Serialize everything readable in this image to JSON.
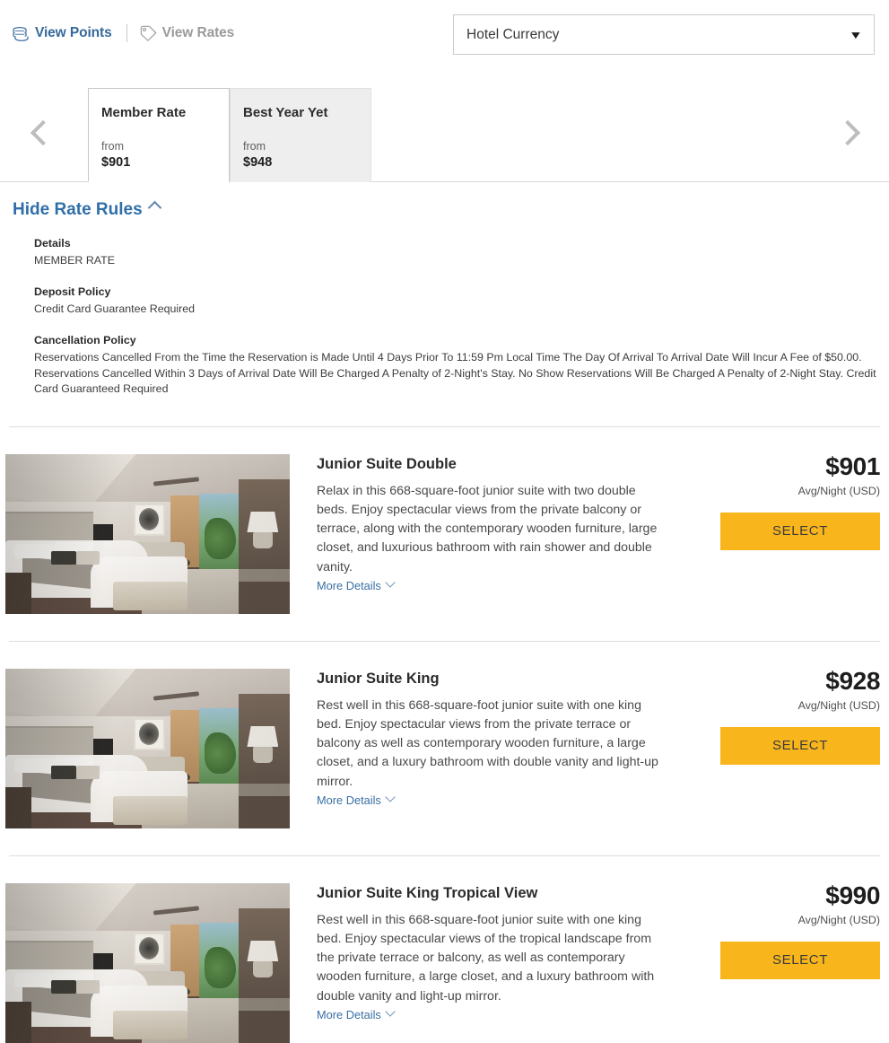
{
  "header": {
    "view_points_label": "View Points",
    "view_points_icon": "stacked-coins-icon",
    "view_rates_label": "View Rates",
    "view_rates_icon": "price-tag-icon",
    "currency": {
      "selected": "Hotel Currency",
      "caret_icon": "chevron-down-icon"
    }
  },
  "carousel": {
    "prev_icon": "chevron-left-icon",
    "next_icon": "chevron-right-icon",
    "tabs": [
      {
        "name": "Member Rate",
        "from_label": "from",
        "price": "$901",
        "state": "active"
      },
      {
        "name": "Best Year Yet",
        "from_label": "from",
        "price": "$948",
        "state": "inactive"
      }
    ]
  },
  "rate_rules": {
    "toggle_label": "Hide Rate Rules",
    "toggle_icon": "chevron-up-icon",
    "expanded": true,
    "groups": [
      {
        "heading": "Details",
        "text": "MEMBER RATE"
      },
      {
        "heading": "Deposit Policy",
        "text": "Credit Card Guarantee Required"
      },
      {
        "heading": "Cancellation Policy",
        "text": "Reservations Cancelled From the Time the Reservation is Made Until 4 Days Prior To 11:59 Pm Local Time The Day Of Arrival To Arrival Date Will Incur A Fee of $50.00. Reservations Cancelled Within 3 Days of Arrival Date Will Be Charged A Penalty of 2-Night's Stay. No Show Reservations Will Be Charged A Penalty of 2-Night Stay. Credit Card Guaranteed Required"
      }
    ]
  },
  "rooms": [
    {
      "title": "Junior Suite Double",
      "description": "Relax in this 668-square-foot junior suite with two double beds. Enjoy spectacular views from the private balcony or terrace, along with the contemporary wooden furniture, large closet, and luxurious bathroom with rain shower and double vanity.",
      "more_details_label": "More Details",
      "more_details_icon": "chevron-down-icon",
      "price": "$901",
      "price_unit": "Avg/Night (USD)",
      "select_label": "SELECT",
      "photo_alt": "hotel-room-two-double-beds"
    },
    {
      "title": "Junior Suite King",
      "description": "Rest well in this 668-square-foot junior suite with one king bed. Enjoy spectacular views from the private terrace or balcony as well as contemporary wooden furniture, a large closet, and a luxury bathroom with double vanity and light-up mirror.",
      "more_details_label": "More Details",
      "more_details_icon": "chevron-down-icon",
      "price": "$928",
      "price_unit": "Avg/Night (USD)",
      "select_label": "SELECT",
      "photo_alt": "hotel-room-king-bed"
    },
    {
      "title": "Junior Suite King Tropical View",
      "description": "Rest well in this 668-square-foot junior suite with one king bed. Enjoy spectacular views of the tropical landscape from the private terrace or balcony, as well as contemporary wooden furniture, a large closet, and a luxury bathroom with double vanity and light-up mirror.",
      "more_details_label": "More Details",
      "more_details_icon": "chevron-down-icon",
      "price": "$990",
      "price_unit": "Avg/Night (USD)",
      "select_label": "SELECT",
      "photo_alt": "hotel-room-king-tropical-view"
    }
  ],
  "colors": {
    "link_blue": "#36699c",
    "select_button": "#f9b61c",
    "muted_grey": "#9a9a9a",
    "tab_inactive_bg": "#eeeeee"
  }
}
